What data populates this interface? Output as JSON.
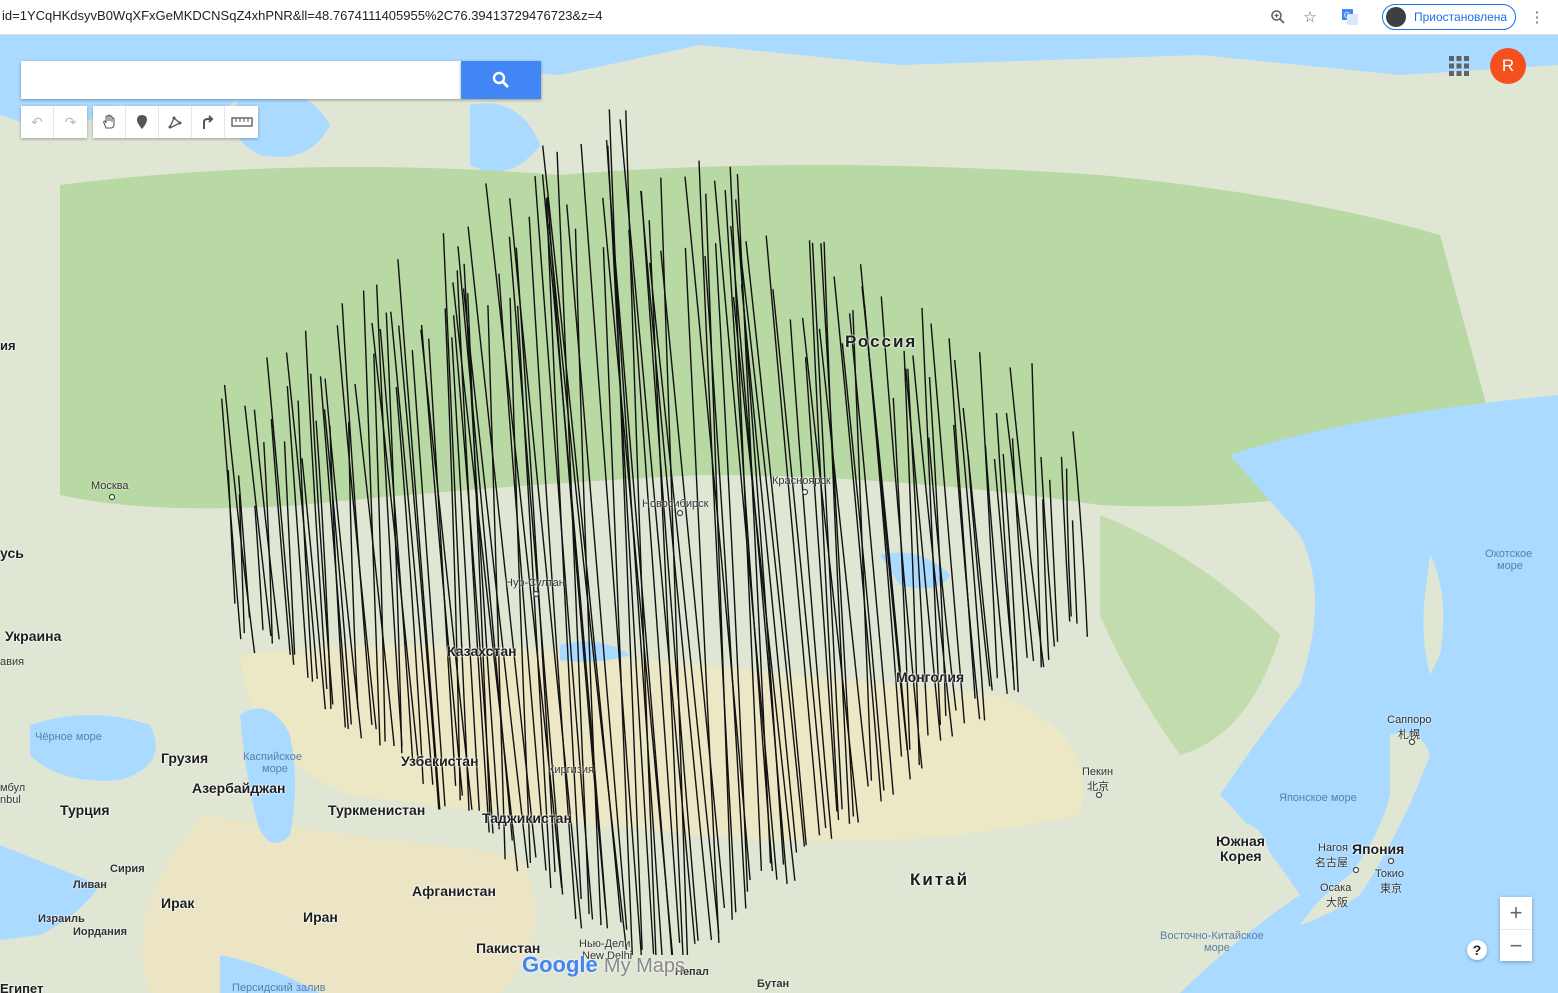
{
  "browser": {
    "url": "id=1YCqHKdsyvB0WqXFxGeMKDCNSqZ4xhPNR&ll=48.7674111405955%2C76.39413729476723&z=4",
    "profile_label": "Приостановлена",
    "icons": [
      "zoom-icon",
      "star-icon",
      "translate-icon",
      "more-vert-icon"
    ]
  },
  "map": {
    "search": {
      "value": "",
      "placeholder": ""
    },
    "avatar_letter": "R",
    "zoom_in": "+",
    "zoom_out": "−",
    "help": "?",
    "logo": {
      "google": "Google",
      "my_maps": "My Maps"
    },
    "countries": {
      "russia": "Россия",
      "kazakhstan": "Казахстан",
      "mongolia": "Монголия",
      "china": "Китай",
      "uzbekistan": "Узбекистан",
      "kyrgyzstan": "Киргизия",
      "tajikistan": "Таджикистан",
      "turkmenistan": "Туркменистан",
      "afghanistan": "Афганистан",
      "pakistan": "Пакистан",
      "iran": "Иран",
      "iraq": "Ирак",
      "turkey": "Турция",
      "syria": "Сирия",
      "lebanon": "Ливан",
      "israel": "Израиль",
      "jordan": "Иордания",
      "egypt": "Египет",
      "georgia": "Грузия",
      "azerbaijan": "Азербайджан",
      "ukraine": "Украина",
      "belarus": "усь",
      "latvia": "авия",
      "south_korea_1": "Южная",
      "south_korea_2": "Корея",
      "japan": "Япония",
      "nepal": "Непал",
      "bhutan": "Бутан",
      "edge_ya": "ия"
    },
    "cities": {
      "moscow": "Москва",
      "novosibirsk": "Новосибирск",
      "krasnoyarsk": "Красноярск",
      "nursultan": "Нур-Султан",
      "beijing_ru": "Пекин",
      "beijing_cn": "北京",
      "sapporo_ru": "Саппоро",
      "sapporo_jp": "札幌",
      "nagoya_ru": "Нагоя",
      "nagoya_jp": "名古屋",
      "tokyo_ru": "Токио",
      "tokyo_jp": "東京",
      "osaka_ru": "Осака",
      "osaka_jp": "大阪",
      "delhi_ru": "Нью-Дели",
      "delhi_en": "New Delhi",
      "istanbul_1": "мбул",
      "istanbul_2": "nbul"
    },
    "water": {
      "black_sea": "Чёрное море",
      "caspian_1": "Каспийское",
      "caspian_2": "море",
      "okhotsk_1": "Охотское",
      "okhotsk_2": "море",
      "japan_sea": "Японское море",
      "east_china_1": "Восточно-Китайское",
      "east_china_2": "море",
      "persian_gulf": "Персидский залив"
    },
    "colors": {
      "land": "#dfe6d4",
      "forest": "#b8d8a4",
      "desert": "#ece7c4",
      "water": "#aadaff",
      "lines": "#111111",
      "search_button": "#4285f4",
      "avatar": "#f4511e"
    }
  }
}
